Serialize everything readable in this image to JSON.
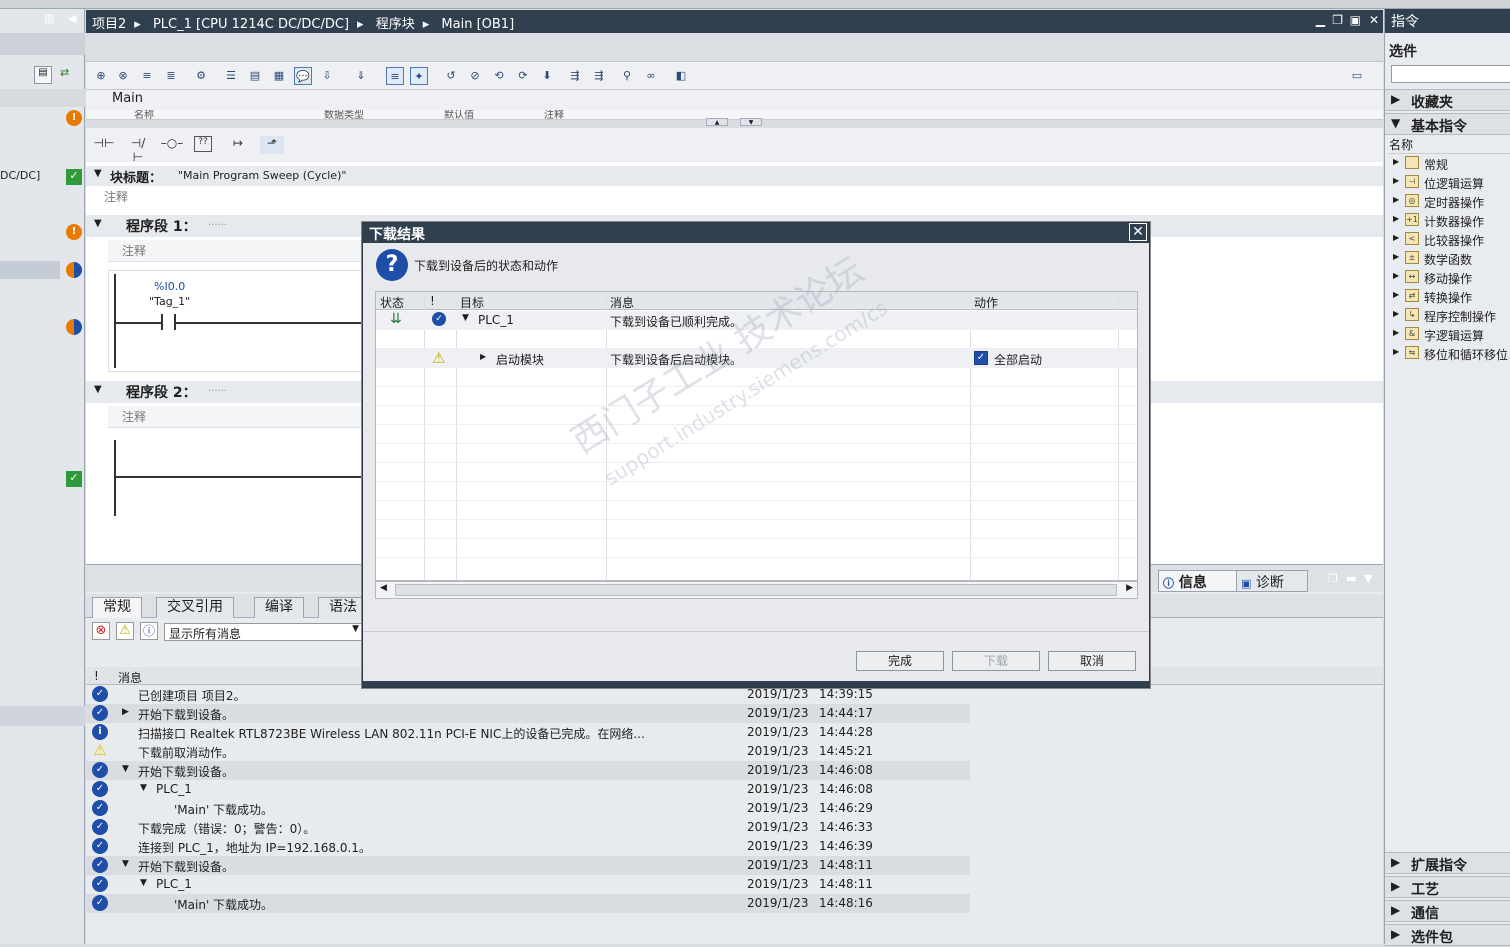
{
  "breadcrumb": [
    "项目2",
    "PLC_1 [CPU 1214C DC/DC/DC]",
    "程序块",
    "Main [OB1]"
  ],
  "left": {
    "device_label": "DC/DC]"
  },
  "editor": {
    "title": "Main",
    "columns": [
      "名称",
      "数据类型",
      "默认值",
      "注释"
    ],
    "block_title_label": "块标题：",
    "block_title_value": "\"Main Program Sweep (Cycle)\"",
    "comment": "注释",
    "segment1": "程序段 1：",
    "segment1_dots": "......",
    "segment2": "程序段 2：",
    "segment2_dots": "......",
    "contact_address": "%I0.0",
    "contact_tag": "\"Tag_1\""
  },
  "dialog": {
    "title": "下载结果",
    "subtitle": "下载到设备后的状态和动作",
    "columns": {
      "status": "状态",
      "bang": "!",
      "target": "目标",
      "message": "消息",
      "action": "动作"
    },
    "rows": [
      {
        "target": "PLC_1",
        "message": "下载到设备已顺利完成。",
        "action": ""
      },
      {
        "target": "启动模块",
        "message": "下载到设备后启动模块。",
        "action": "全部启动"
      }
    ],
    "buttons": {
      "finish": "完成",
      "download": "下载",
      "cancel": "取消"
    }
  },
  "info": {
    "tabs": [
      "常规",
      "交叉引用",
      "编译",
      "语法"
    ],
    "right_tabs": [
      "信息",
      "诊断"
    ],
    "filter": "显示所有消息",
    "msg_header_bang": "!",
    "msg_header": "消息",
    "messages": [
      {
        "icon": "ok",
        "text": "已创建项目 项目2。",
        "date": "2019/1/23",
        "time": "14:39:15",
        "indent": 0,
        "arrow": ""
      },
      {
        "icon": "ok",
        "text": "开始下载到设备。",
        "date": "2019/1/23",
        "time": "14:44:17",
        "indent": 0,
        "arrow": "▶"
      },
      {
        "icon": "info",
        "text": "扫描接口 Realtek RTL8723BE Wireless LAN 802.11n PCI-E NIC上的设备已完成。在网络...",
        "date": "2019/1/23",
        "time": "14:44:28",
        "indent": 0,
        "arrow": ""
      },
      {
        "icon": "warn",
        "text": "下载前取消动作。",
        "date": "2019/1/23",
        "time": "14:45:21",
        "indent": 0,
        "arrow": ""
      },
      {
        "icon": "ok",
        "text": "开始下载到设备。",
        "date": "2019/1/23",
        "time": "14:46:08",
        "indent": 0,
        "arrow": "▼"
      },
      {
        "icon": "ok",
        "text": "PLC_1",
        "date": "2019/1/23",
        "time": "14:46:08",
        "indent": 1,
        "arrow": "▼"
      },
      {
        "icon": "ok",
        "text": "'Main' 下载成功。",
        "date": "2019/1/23",
        "time": "14:46:29",
        "indent": 2,
        "arrow": ""
      },
      {
        "icon": "ok",
        "text": "下载完成（错误：0；警告：0）。",
        "date": "2019/1/23",
        "time": "14:46:33",
        "indent": 0,
        "arrow": ""
      },
      {
        "icon": "ok",
        "text": "连接到 PLC_1，地址为 IP=192.168.0.1。",
        "date": "2019/1/23",
        "time": "14:46:39",
        "indent": 0,
        "arrow": ""
      },
      {
        "icon": "ok",
        "text": "开始下载到设备。",
        "date": "2019/1/23",
        "time": "14:48:11",
        "indent": 0,
        "arrow": "▼"
      },
      {
        "icon": "ok",
        "text": "PLC_1",
        "date": "2019/1/23",
        "time": "14:48:11",
        "indent": 1,
        "arrow": "▼"
      },
      {
        "icon": "ok",
        "text": "'Main' 下载成功。",
        "date": "2019/1/23",
        "time": "14:48:16",
        "indent": 2,
        "arrow": ""
      }
    ]
  },
  "right": {
    "title": "指令",
    "options": "选件",
    "favorites": "收藏夹",
    "basic": "基本指令",
    "name_col": "名称",
    "items": [
      "常规",
      "位逻辑运算",
      "定时器操作",
      "计数器操作",
      "比较器操作",
      "数学函数",
      "移动操作",
      "转换操作",
      "程序控制操作",
      "字逻辑运算",
      "移位和循环移位"
    ],
    "bottom": [
      "扩展指令",
      "工艺",
      "通信",
      "选件包"
    ]
  },
  "watermark": {
    "line1": "西门子工业 技术论坛",
    "line2": "support.industry.siemens.com/cs"
  }
}
